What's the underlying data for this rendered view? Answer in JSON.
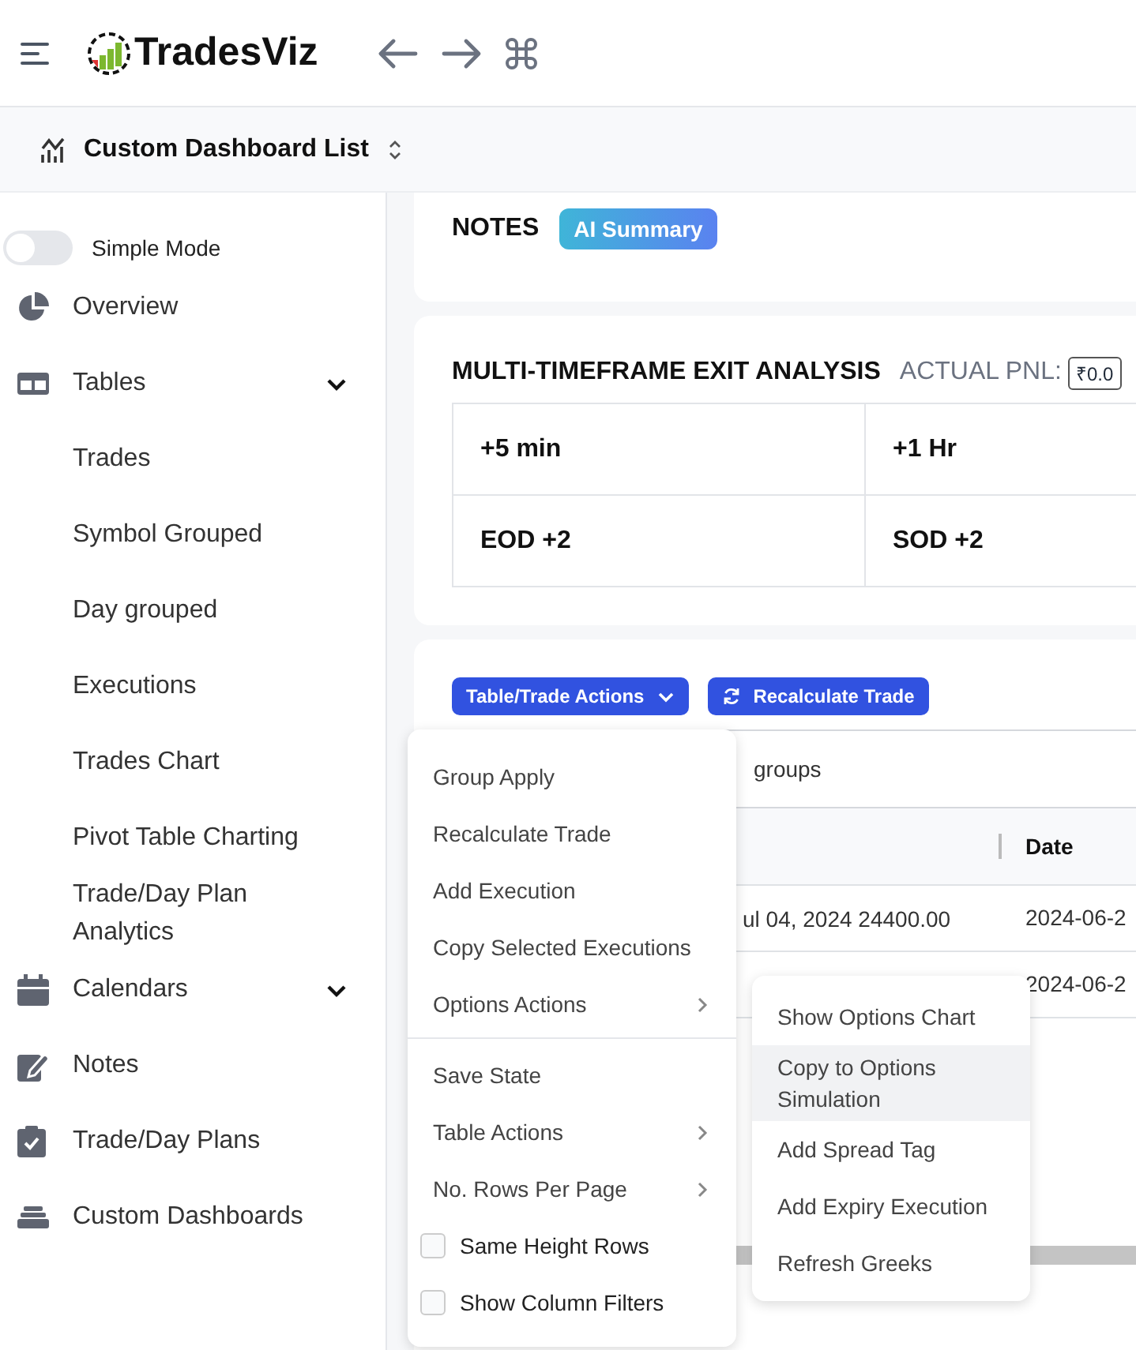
{
  "header": {
    "brand": "TradesViz"
  },
  "subheader": {
    "title": "Custom Dashboard List"
  },
  "sidebar": {
    "simple_mode": {
      "label": "Simple Mode",
      "on": false
    },
    "items": [
      {
        "label": "Overview",
        "kind": "link"
      },
      {
        "label": "Tables",
        "kind": "group",
        "children": [
          {
            "label": "Trades"
          },
          {
            "label": "Symbol Grouped"
          },
          {
            "label": "Day grouped"
          },
          {
            "label": "Executions"
          },
          {
            "label": "Trades Chart"
          },
          {
            "label": "Pivot Table Charting"
          },
          {
            "label": "Trade/Day Plan Analytics"
          }
        ]
      },
      {
        "label": "Calendars",
        "kind": "group"
      },
      {
        "label": "Notes",
        "kind": "link"
      },
      {
        "label": "Trade/Day Plans",
        "kind": "link"
      },
      {
        "label": "Custom Dashboards",
        "kind": "link"
      }
    ]
  },
  "notes_card": {
    "title": "NOTES",
    "ai_button": "AI Summary"
  },
  "exit_analysis": {
    "title": "MULTI-TIMEFRAME EXIT ANALYSIS",
    "pnl_label": "ACTUAL PNL:",
    "pnl_value": "₹0.0",
    "cells": [
      "+5 min",
      "+1 Hr",
      "EOD +2",
      "SOD +2"
    ]
  },
  "trades_card": {
    "actions_button": "Table/Trade Actions",
    "recalc_button": "Recalculate Trade",
    "group_bar": "groups",
    "date_column": "Date",
    "rows": [
      {
        "instrument": "ul 04, 2024 24400.00",
        "date": "2024-06-2"
      },
      {
        "date": "2024-06-2"
      }
    ]
  },
  "menu": {
    "items": [
      {
        "kind": "action",
        "label": "Group Apply"
      },
      {
        "kind": "action",
        "label": "Recalculate Trade"
      },
      {
        "kind": "action",
        "label": "Add Execution"
      },
      {
        "kind": "action",
        "label": "Copy Selected Executions"
      },
      {
        "kind": "submenu",
        "label": "Options Actions"
      },
      {
        "kind": "divider"
      },
      {
        "kind": "action",
        "label": "Save State"
      },
      {
        "kind": "submenu",
        "label": "Table Actions"
      },
      {
        "kind": "submenu",
        "label": "No. Rows Per Page"
      },
      {
        "kind": "checkbox",
        "label": "Same Height Rows",
        "checked": false
      },
      {
        "kind": "checkbox",
        "label": "Show Column Filters",
        "checked": false
      }
    ]
  },
  "submenu": {
    "items": [
      {
        "label": "Show Options Chart",
        "highlighted": false
      },
      {
        "label": "Copy to Options Simulation",
        "highlighted": true
      },
      {
        "label": "Add Spread Tag",
        "highlighted": false
      },
      {
        "label": "Add Expiry Execution",
        "highlighted": false
      },
      {
        "label": "Refresh Greeks",
        "highlighted": false
      }
    ]
  }
}
